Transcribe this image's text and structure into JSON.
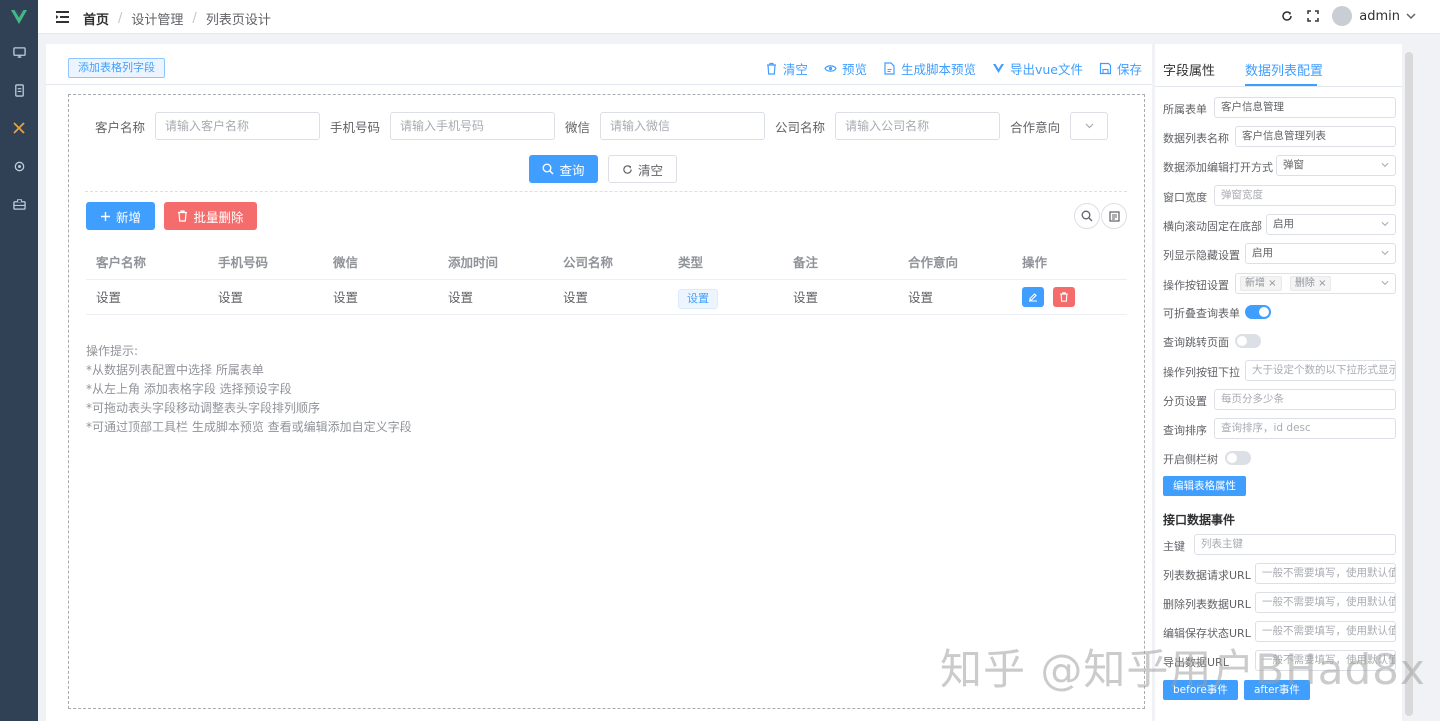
{
  "colors": {
    "primary": "#409eff",
    "danger": "#f56c6c",
    "sidebar": "#304156",
    "logo": "#42b983"
  },
  "sidebar": {
    "icons": [
      "vue-logo-icon",
      "monitor-icon",
      "document-icon",
      "tools-icon",
      "gear-icon",
      "briefcase-icon"
    ]
  },
  "header": {
    "breadcrumb": [
      "首页",
      "设计管理",
      "列表页设计"
    ],
    "username": "admin"
  },
  "toolbar": {
    "add_field": "添加表格列字段",
    "clear": "清空",
    "preview": "预览",
    "gen_script": "生成脚本预览",
    "export_vue": "导出vue文件",
    "save": "保存"
  },
  "search": {
    "fields": [
      {
        "label": "客户名称",
        "placeholder": "请输入客户名称"
      },
      {
        "label": "手机号码",
        "placeholder": "请输入手机号码"
      },
      {
        "label": "微信",
        "placeholder": "请输入微信"
      },
      {
        "label": "公司名称",
        "placeholder": "请输入公司名称"
      },
      {
        "label": "合作意向",
        "placeholder": ""
      }
    ],
    "query_label": "查询",
    "clear_label": "清空"
  },
  "actions": {
    "add_label": "新增",
    "batch_delete_label": "批量删除"
  },
  "table": {
    "headers": [
      "客户名称",
      "手机号码",
      "微信",
      "添加时间",
      "公司名称",
      "类型",
      "备注",
      "合作意向",
      "操作"
    ],
    "row": [
      "设置",
      "设置",
      "设置",
      "设置",
      "设置",
      "设置",
      "设置",
      "设置"
    ]
  },
  "tips": {
    "title": "操作提示:",
    "lines": [
      "*从数据列表配置中选择 所属表单",
      "*从左上角 添加表格字段 选择预设字段",
      "*可拖动表头字段移动调整表头字段排列顺序",
      "*可通过顶部工具栏 生成脚本预览 查看或编辑添加自定义字段"
    ]
  },
  "panel": {
    "tabs": [
      "字段属性",
      "数据列表配置"
    ],
    "active_tab": "数据列表配置",
    "form_label": "所属表单",
    "form_value": "客户信息管理",
    "name_label": "数据列表名称",
    "name_value": "客户信息管理列表",
    "open_mode_label": "数据添加编辑打开方式",
    "open_mode_value": "弹窗",
    "width_label": "窗口宽度",
    "width_placeholder": "弹窗宽度",
    "hscroll_label": "横向滚动固定在底部",
    "hscroll_value": "启用",
    "colhide_label": "列显示隐藏设置",
    "colhide_value": "启用",
    "opbtn_label": "操作按钮设置",
    "opbtn_tags": [
      "新增",
      "删除"
    ],
    "collapse_label": "可折叠查询表单",
    "collapse_on": true,
    "jump_label": "查询跳转页面",
    "jump_on": false,
    "dropdown_label": "操作列按钮下拉",
    "dropdown_placeholder": "大于设定个数的以下拉形式显示",
    "page_label": "分页设置",
    "page_placeholder": "每页分多少条",
    "sort_label": "查询排序",
    "sort_placeholder": "查询排序，id desc",
    "tree_label": "开启侧栏树",
    "tree_on": false,
    "edit_table_btn": "编辑表格属性",
    "api_title": "接口数据事件",
    "pk_label": "主键",
    "pk_placeholder": "列表主键",
    "list_url_label": "列表数据请求URL",
    "list_url_placeholder": "一般不需要填写，使用默认值",
    "del_url_label": "删除列表数据URL",
    "del_url_placeholder": "一般不需要填写，使用默认值",
    "save_url_label": "编辑保存状态URL",
    "save_url_placeholder": "一般不需要填写，使用默认值",
    "export_url_label": "导出数据URL",
    "export_url_placeholder": "一般不需要填写，使用默认值",
    "before_btn": "before事件",
    "after_btn": "after事件"
  },
  "watermark": "知乎 @知乎用户BHad8x"
}
